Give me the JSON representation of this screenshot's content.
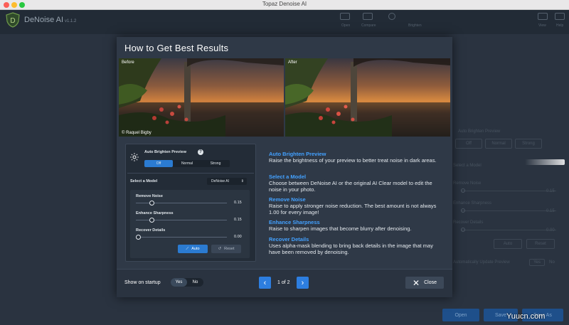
{
  "window": {
    "title": "Topaz Denoise AI"
  },
  "app": {
    "name": "DeNoise AI",
    "version": "v1.1.2",
    "header_labels": [
      "Open",
      "Compare",
      "Brighten"
    ],
    "header_right_labels": [
      "View",
      "Help"
    ],
    "side": {
      "auto_brighten": "Auto Brighten Preview",
      "options": [
        "Off",
        "Normal",
        "Strong"
      ],
      "model": "Select a Model",
      "remove_noise": "Remove Noise",
      "enhance_sharpness": "Enhance Sharpness",
      "recover_details": "Recover Details",
      "auto": "Auto",
      "reset": "Reset",
      "update": "Automatically Update Preview",
      "yes": "Yes",
      "no": "No",
      "values": [
        "0.15",
        "0.15",
        "0.00"
      ]
    },
    "bottom": {
      "open": "Open",
      "save": "Save",
      "save_as": "Save As"
    }
  },
  "modal": {
    "title": "How to Get Best Results",
    "before_label": "Before",
    "after_label": "After",
    "credit": "© Raquel Bigby",
    "panel": {
      "auto_brighten": "Auto Brighten Preview",
      "brighten_options": [
        "Off",
        "Normal",
        "Strong"
      ],
      "select_model": "Select a Model",
      "model_value": "DeNoise AI",
      "sliders": [
        {
          "label": "Remove Noise",
          "value": "0.15",
          "level": 0.15
        },
        {
          "label": "Enhance Sharpness",
          "value": "0.15",
          "level": 0.15
        },
        {
          "label": "Recover Details",
          "value": "0.00",
          "level": 0.0
        }
      ],
      "auto_label": "Auto",
      "reset_label": "Reset"
    },
    "tips": [
      {
        "heading": "Auto Brighten Preview",
        "body": "Raise the brightness of your preview to better treat noise in dark areas."
      },
      {
        "heading": "Select a Model",
        "body": "Choose between DeNoise AI or the original AI Clear model to edit the noise in your photo."
      },
      {
        "heading": "Remove Noise",
        "body": "Raise to apply stronger noise reduction. The best amount is not always 1.00 for every image!"
      },
      {
        "heading": "Enhance Sharpness",
        "body": "Raise to sharpen images that become blurry after denoising."
      },
      {
        "heading": "Recover Details",
        "body": "Uses alpha-mask blending to bring back details in the image that may have been removed by denoising."
      }
    ],
    "footer": {
      "show_on_startup": "Show on startup",
      "yes": "Yes",
      "no": "No",
      "page": "1 of 2",
      "close": "Close"
    }
  },
  "watermark": "Yuucn.com",
  "colors": {
    "accent": "#2d7ee0",
    "tip_heading": "#43a1ff",
    "modal_bg": "#2f3947"
  }
}
